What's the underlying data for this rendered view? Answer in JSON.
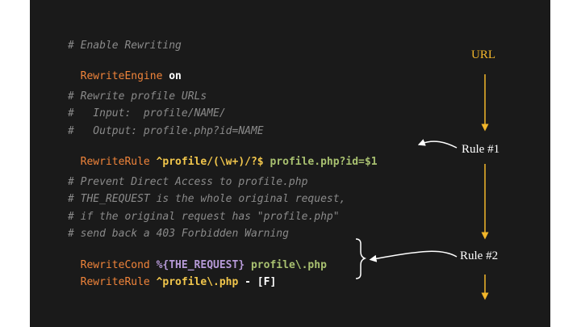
{
  "code": {
    "line1": "# Enable Rewriting",
    "line2": {
      "kw": "RewriteEngine",
      "val": "on"
    },
    "line3": "# Rewrite profile URLs",
    "line4": "#   Input:  profile/NAME/",
    "line5": "#   Output: profile.php?id=NAME",
    "line6": {
      "kw": "RewriteRule",
      "pattern": "^profile/(\\w+)/?$",
      "target": "profile.php?id=$1"
    },
    "line7": "# Prevent Direct Access to profile.php",
    "line8": "# THE_REQUEST is the whole original request,",
    "line9": "# if the original request has \"profile.php\"",
    "line10": "# send back a 403 Forbidden Warning",
    "line11": {
      "kw": "RewriteCond",
      "var": "%{THE_REQUEST}",
      "pattern": "profile\\.php"
    },
    "line12": {
      "kw": "RewriteRule",
      "pattern": "^profile\\.php",
      "rest": "- [F]"
    }
  },
  "annotations": {
    "url": "URL",
    "rule1": "Rule #1",
    "rule2": "Rule #2"
  },
  "colors": {
    "background": "#1a1a1a",
    "comment": "#8a8a8a",
    "keyword": "#f0843a",
    "pattern": "#f1c64c",
    "target": "#a8c070",
    "variable": "#b79ad8",
    "arrow": "#f2b62a"
  }
}
